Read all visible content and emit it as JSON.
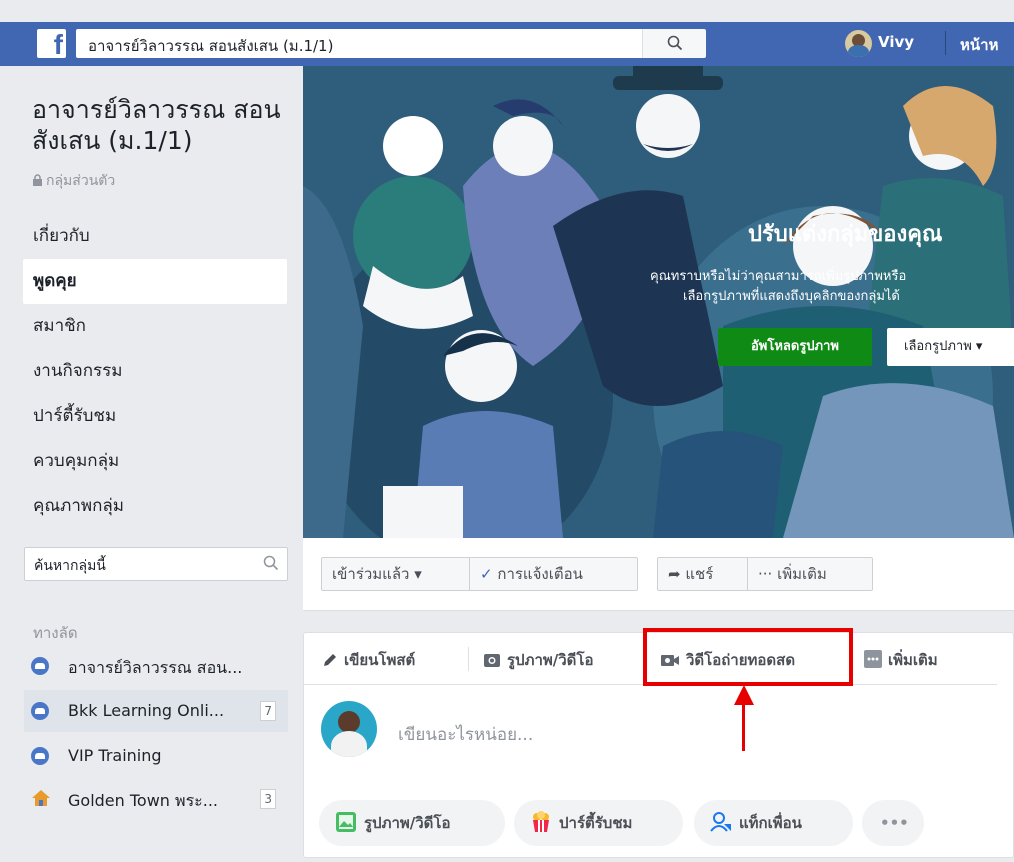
{
  "topbar": {
    "logo": "f",
    "search_value": "อาจารย์วิลาวรรณ สอนสังเสน (ม.1/1)",
    "user_name": "Vivy",
    "home_label": "หน้าห"
  },
  "sidebar": {
    "group_name": "อาจารย์วิลาวรรณ สอนสังเสน (ม.1/1)",
    "privacy": "กลุ่มส่วนตัว",
    "nav": [
      {
        "label": "เกี่ยวกับ"
      },
      {
        "label": "พูดคุย"
      },
      {
        "label": "สมาชิก"
      },
      {
        "label": "งานกิจกรรม"
      },
      {
        "label": "ปาร์ตี้รับชม"
      },
      {
        "label": "ควบคุมกลุ่ม"
      },
      {
        "label": "คุณภาพกลุ่ม"
      }
    ],
    "group_search_placeholder": "ค้นหากลุ่มนี้",
    "shortcuts_title": "ทางลัด",
    "shortcuts": [
      {
        "label": "อาจารย์วิลาวรรณ สอน...",
        "count": ""
      },
      {
        "label": "Bkk Learning Onli...",
        "count": "7"
      },
      {
        "label": "VIP Training",
        "count": ""
      },
      {
        "label": "Golden Town พระ...",
        "count": "3"
      }
    ]
  },
  "cover": {
    "headline": "ปรับแต่งกลุ่มของคุณ",
    "sub_line1": "คุณทราบหรือไม่ว่าคุณสามารถเพิ่มรูปภาพหรือ",
    "sub_line2": "เลือกรูปภาพที่แสดงถึงบุคลิกของกลุ่มได้",
    "upload_button": "อัพโหลดรูปภาพ",
    "choose_button": "เลือกรูปภาพ"
  },
  "actions": {
    "joined": "เข้าร่วมแล้ว ▾",
    "notifications": "การแจ้งเตือน",
    "share": "แชร์",
    "more": "··· เพิ่มเติม"
  },
  "composer": {
    "tabs": {
      "write": "เขียนโพสต์",
      "photo_video": "รูปภาพ/วิดีโอ",
      "live_video": "วิดีโอถ่ายทอดสด",
      "more": "เพิ่มเติม"
    },
    "placeholder": "เขียนอะไรหน่อย...",
    "chips": {
      "photo_video": "รูปภาพ/วิดีโอ",
      "watch_party": "ปาร์ตี้รับชม",
      "tag_friends": "แท็กเพื่อน",
      "more": "•••"
    }
  },
  "colors": {
    "brand_blue": "#4267b2",
    "upload_green": "#0f8a14",
    "annotation_red": "#e60000"
  }
}
